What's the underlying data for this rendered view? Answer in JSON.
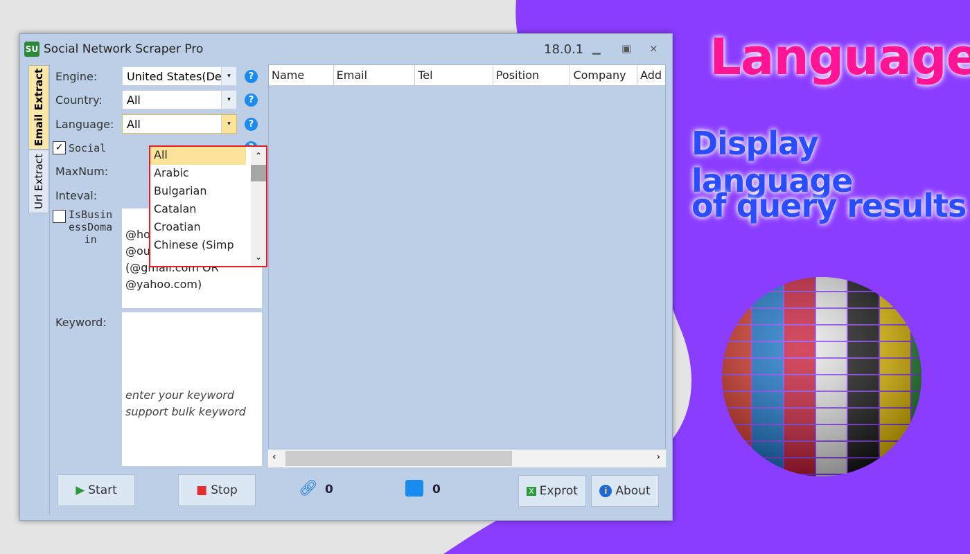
{
  "window": {
    "title": "Social Network Scraper Pro",
    "version": "18.0.1",
    "logo_text": "SU"
  },
  "tabs": [
    {
      "label": "Email Extract",
      "active": true
    },
    {
      "label": "Url Extract",
      "active": false
    }
  ],
  "form": {
    "engine": {
      "label": "Engine:",
      "value": "United States(De"
    },
    "country": {
      "label": "Country:",
      "value": "All"
    },
    "language": {
      "label": "Language:",
      "value": "All",
      "options": [
        "All",
        "Arabic",
        "Bulgarian",
        "Catalan",
        "Croatian",
        "Chinese (Simp"
      ]
    },
    "social": {
      "label": "Social",
      "checked": true
    },
    "maxnum": {
      "label": "MaxNum:"
    },
    "inteval": {
      "label": "Inteval:"
    },
    "business": {
      "label": "IsBusinessDomain",
      "lines": [
        "IsBusin",
        "essDoma",
        "in"
      ],
      "checked": false
    },
    "domains": [
      "@hotmail.com",
      "@outlook.com",
      "(@gmail.com OR",
      "@yahoo.com)"
    ],
    "keyword": {
      "label": "Keyword:",
      "placeholder_lines": [
        "enter your keyword",
        "support bulk keyword"
      ]
    }
  },
  "buttons": {
    "start": "Start",
    "stop": "Stop",
    "export": "Exprot",
    "about": "About"
  },
  "table": {
    "columns": [
      "Name",
      "Email",
      "Tel",
      "Position",
      "Company",
      "Add"
    ]
  },
  "status": {
    "links": "0",
    "emails": "0"
  },
  "promo": {
    "title": "Language",
    "line1": "Display language",
    "line2": "of query results"
  },
  "colors": {
    "accent_purple": "#8a3cff",
    "highlight_red": "#e81c24",
    "title_pink": "#ff1493",
    "text_blue": "#2a4cff"
  }
}
